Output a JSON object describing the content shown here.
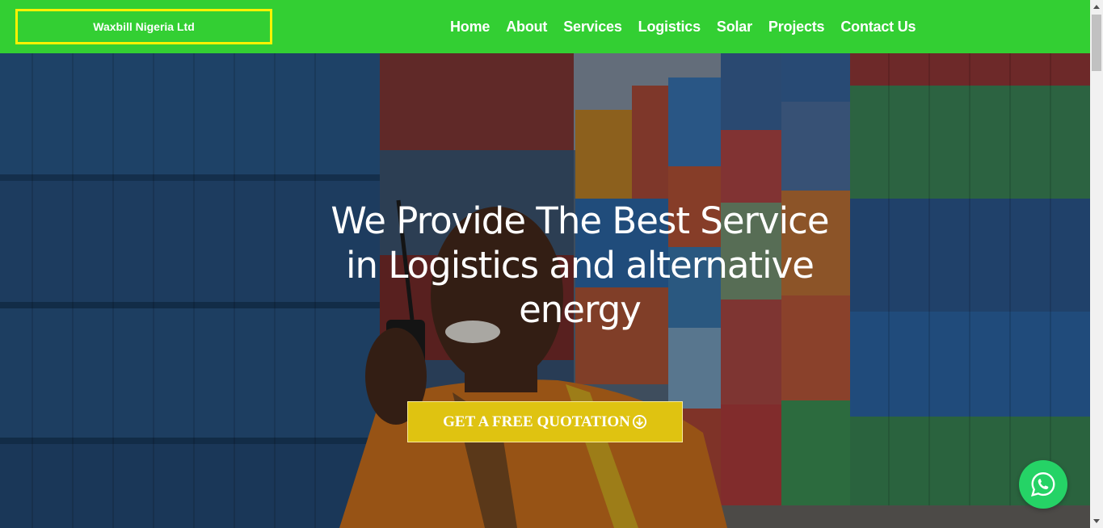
{
  "brand": {
    "label": "Waxbill Nigeria Ltd"
  },
  "nav": {
    "items": [
      {
        "label": "Home"
      },
      {
        "label": "About"
      },
      {
        "label": "Services"
      },
      {
        "label": "Logistics"
      },
      {
        "label": "Solar"
      },
      {
        "label": "Projects"
      },
      {
        "label": "Contact Us"
      }
    ]
  },
  "hero": {
    "headline": "We Provide The Best Service in Logistics and alternative energy",
    "cta_label": "GET A FREE QUOTATION",
    "cta_icon": "arrow-circle-down-icon",
    "background": "shipping-containers-worker-photo"
  },
  "floating": {
    "icon": "whatsapp-icon"
  },
  "colors": {
    "nav_bg": "#33cf33",
    "brand_border": "#fff200",
    "cta_bg": "#dfc311",
    "whatsapp": "#25d366",
    "text": "#ffffff"
  }
}
